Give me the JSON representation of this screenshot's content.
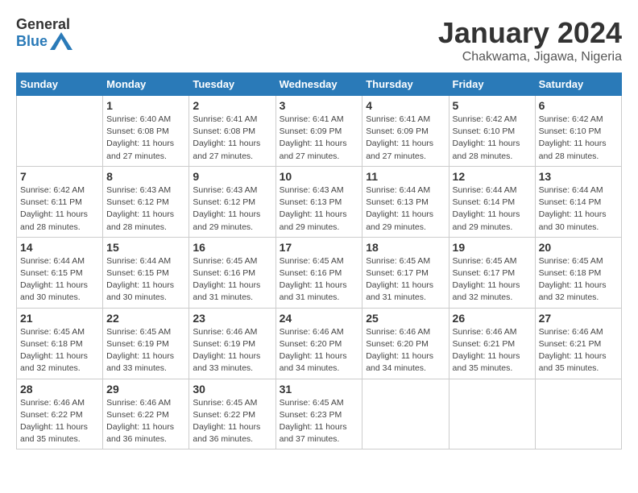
{
  "header": {
    "logo_general": "General",
    "logo_blue": "Blue",
    "title": "January 2024",
    "subtitle": "Chakwama, Jigawa, Nigeria"
  },
  "calendar": {
    "days_of_week": [
      "Sunday",
      "Monday",
      "Tuesday",
      "Wednesday",
      "Thursday",
      "Friday",
      "Saturday"
    ],
    "weeks": [
      [
        {
          "day": "",
          "info": ""
        },
        {
          "day": "1",
          "info": "Sunrise: 6:40 AM\nSunset: 6:08 PM\nDaylight: 11 hours\nand 27 minutes."
        },
        {
          "day": "2",
          "info": "Sunrise: 6:41 AM\nSunset: 6:08 PM\nDaylight: 11 hours\nand 27 minutes."
        },
        {
          "day": "3",
          "info": "Sunrise: 6:41 AM\nSunset: 6:09 PM\nDaylight: 11 hours\nand 27 minutes."
        },
        {
          "day": "4",
          "info": "Sunrise: 6:41 AM\nSunset: 6:09 PM\nDaylight: 11 hours\nand 27 minutes."
        },
        {
          "day": "5",
          "info": "Sunrise: 6:42 AM\nSunset: 6:10 PM\nDaylight: 11 hours\nand 28 minutes."
        },
        {
          "day": "6",
          "info": "Sunrise: 6:42 AM\nSunset: 6:10 PM\nDaylight: 11 hours\nand 28 minutes."
        }
      ],
      [
        {
          "day": "7",
          "info": "Sunrise: 6:42 AM\nSunset: 6:11 PM\nDaylight: 11 hours\nand 28 minutes."
        },
        {
          "day": "8",
          "info": "Sunrise: 6:43 AM\nSunset: 6:12 PM\nDaylight: 11 hours\nand 28 minutes."
        },
        {
          "day": "9",
          "info": "Sunrise: 6:43 AM\nSunset: 6:12 PM\nDaylight: 11 hours\nand 29 minutes."
        },
        {
          "day": "10",
          "info": "Sunrise: 6:43 AM\nSunset: 6:13 PM\nDaylight: 11 hours\nand 29 minutes."
        },
        {
          "day": "11",
          "info": "Sunrise: 6:44 AM\nSunset: 6:13 PM\nDaylight: 11 hours\nand 29 minutes."
        },
        {
          "day": "12",
          "info": "Sunrise: 6:44 AM\nSunset: 6:14 PM\nDaylight: 11 hours\nand 29 minutes."
        },
        {
          "day": "13",
          "info": "Sunrise: 6:44 AM\nSunset: 6:14 PM\nDaylight: 11 hours\nand 30 minutes."
        }
      ],
      [
        {
          "day": "14",
          "info": "Sunrise: 6:44 AM\nSunset: 6:15 PM\nDaylight: 11 hours\nand 30 minutes."
        },
        {
          "day": "15",
          "info": "Sunrise: 6:44 AM\nSunset: 6:15 PM\nDaylight: 11 hours\nand 30 minutes."
        },
        {
          "day": "16",
          "info": "Sunrise: 6:45 AM\nSunset: 6:16 PM\nDaylight: 11 hours\nand 31 minutes."
        },
        {
          "day": "17",
          "info": "Sunrise: 6:45 AM\nSunset: 6:16 PM\nDaylight: 11 hours\nand 31 minutes."
        },
        {
          "day": "18",
          "info": "Sunrise: 6:45 AM\nSunset: 6:17 PM\nDaylight: 11 hours\nand 31 minutes."
        },
        {
          "day": "19",
          "info": "Sunrise: 6:45 AM\nSunset: 6:17 PM\nDaylight: 11 hours\nand 32 minutes."
        },
        {
          "day": "20",
          "info": "Sunrise: 6:45 AM\nSunset: 6:18 PM\nDaylight: 11 hours\nand 32 minutes."
        }
      ],
      [
        {
          "day": "21",
          "info": "Sunrise: 6:45 AM\nSunset: 6:18 PM\nDaylight: 11 hours\nand 32 minutes."
        },
        {
          "day": "22",
          "info": "Sunrise: 6:45 AM\nSunset: 6:19 PM\nDaylight: 11 hours\nand 33 minutes."
        },
        {
          "day": "23",
          "info": "Sunrise: 6:46 AM\nSunset: 6:19 PM\nDaylight: 11 hours\nand 33 minutes."
        },
        {
          "day": "24",
          "info": "Sunrise: 6:46 AM\nSunset: 6:20 PM\nDaylight: 11 hours\nand 34 minutes."
        },
        {
          "day": "25",
          "info": "Sunrise: 6:46 AM\nSunset: 6:20 PM\nDaylight: 11 hours\nand 34 minutes."
        },
        {
          "day": "26",
          "info": "Sunrise: 6:46 AM\nSunset: 6:21 PM\nDaylight: 11 hours\nand 35 minutes."
        },
        {
          "day": "27",
          "info": "Sunrise: 6:46 AM\nSunset: 6:21 PM\nDaylight: 11 hours\nand 35 minutes."
        }
      ],
      [
        {
          "day": "28",
          "info": "Sunrise: 6:46 AM\nSunset: 6:22 PM\nDaylight: 11 hours\nand 35 minutes."
        },
        {
          "day": "29",
          "info": "Sunrise: 6:46 AM\nSunset: 6:22 PM\nDaylight: 11 hours\nand 36 minutes."
        },
        {
          "day": "30",
          "info": "Sunrise: 6:45 AM\nSunset: 6:22 PM\nDaylight: 11 hours\nand 36 minutes."
        },
        {
          "day": "31",
          "info": "Sunrise: 6:45 AM\nSunset: 6:23 PM\nDaylight: 11 hours\nand 37 minutes."
        },
        {
          "day": "",
          "info": ""
        },
        {
          "day": "",
          "info": ""
        },
        {
          "day": "",
          "info": ""
        }
      ]
    ]
  }
}
